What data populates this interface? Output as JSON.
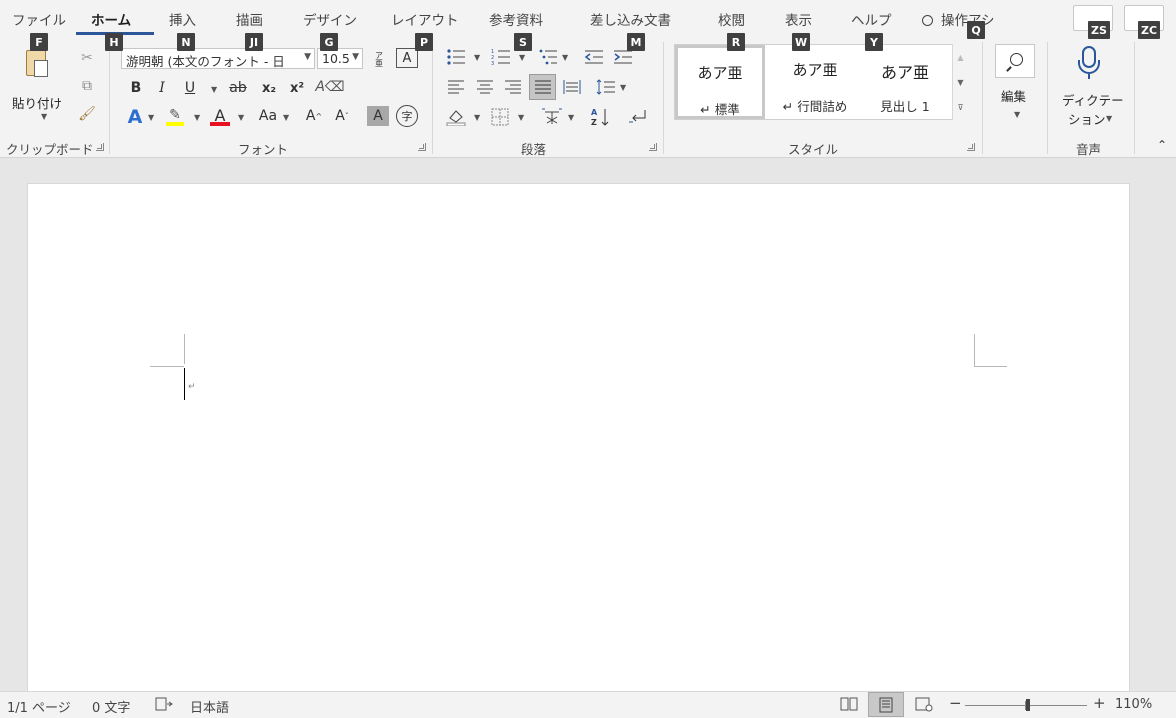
{
  "tabs": [
    {
      "label": "ファイル"
    },
    {
      "label": "ホーム"
    },
    {
      "label": "挿入"
    },
    {
      "label": "描画"
    },
    {
      "label": "デザイン"
    },
    {
      "label": "レイアウト"
    },
    {
      "label": "参考資料"
    },
    {
      "label": "差し込み文書"
    },
    {
      "label": "校閲"
    },
    {
      "label": "表示"
    },
    {
      "label": "ヘルプ"
    }
  ],
  "search_label": "操作アシ",
  "keytips": {
    "file": "F",
    "home": "H",
    "insert": "N",
    "draw": "JI",
    "design": "G",
    "layout": "P",
    "references": "S",
    "mailings": "M",
    "review": "R",
    "view": "W",
    "help": "Y",
    "tellme": "Q",
    "share": "ZS",
    "comments": "ZC"
  },
  "clipboard": {
    "paste_label": "貼り付け",
    "group_label": "クリップボード"
  },
  "font": {
    "name": "游明朝 (本文のフォント - 日",
    "size": "10.5",
    "furigana_icon": "ア亜",
    "group_label": "フォント",
    "bold": "B",
    "italic": "I",
    "underline": "U",
    "strike": "ab",
    "subscript": "x₂",
    "superscript": "x²",
    "change_case": "Aa",
    "grow": "A",
    "shrink": "A",
    "shade": "A",
    "enclose": "字"
  },
  "paragraph": {
    "group_label": "段落"
  },
  "styles": {
    "group_label": "スタイル",
    "items": [
      {
        "sample": "あア亜",
        "name": "↵ 標準"
      },
      {
        "sample": "あア亜",
        "name": "↵ 行間詰め"
      },
      {
        "sample": "あア亜",
        "name": "見出し 1"
      }
    ]
  },
  "editing": {
    "label": "編集"
  },
  "voice": {
    "dictate_line1": "ディクテー",
    "dictate_line2": "ション",
    "group_label": "音声"
  },
  "status": {
    "page": "1/1 ページ",
    "words": "0 文字",
    "language": "日本語",
    "zoom": "110%"
  },
  "colors": {
    "accent": "#2b579a",
    "highlight": "#ffff00",
    "font_color": "#e81123"
  }
}
